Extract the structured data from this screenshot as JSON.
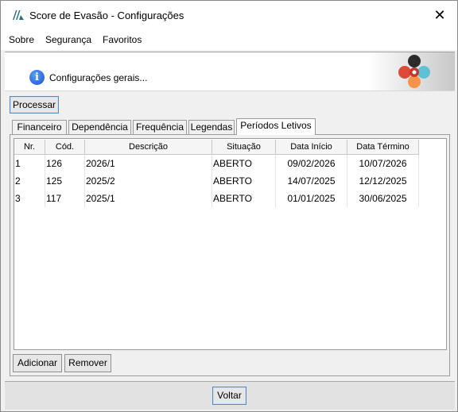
{
  "window": {
    "title": "Score de Evasão - Configurações",
    "close_glyph": "✕"
  },
  "menu": {
    "items": [
      "Sobre",
      "Segurança",
      "Favoritos"
    ]
  },
  "header": {
    "text": "Configurações gerais..."
  },
  "actions": {
    "process_label": "Processar"
  },
  "tabs": [
    "Financeiro",
    "Dependência",
    "Frequência",
    "Legendas",
    "Períodos Letivos"
  ],
  "active_tab": "Períodos Letivos",
  "table": {
    "columns": [
      "Nr.",
      "Cód.",
      "Descrição",
      "Situação",
      "Data Início",
      "Data Término"
    ],
    "rows": [
      [
        "1",
        "126",
        "2026/1",
        "ABERTO",
        "09/02/2026",
        "10/07/2026"
      ],
      [
        "2",
        "125",
        "2025/2",
        "ABERTO",
        "14/07/2025",
        "12/12/2025"
      ],
      [
        "3",
        "117",
        "2025/1",
        "ABERTO",
        "01/01/2025",
        "30/06/2025"
      ]
    ]
  },
  "panel_buttons": {
    "add_label": "Adicionar",
    "remove_label": "Remover"
  },
  "footer": {
    "back_label": "Voltar"
  },
  "icons": {
    "app": "app-logo-icon",
    "close": "close-icon",
    "info": "info-icon",
    "brand": "brand-logo"
  },
  "colors": {
    "info_blue": "#1b4fc4",
    "logo_red": "#e0483a",
    "logo_teal": "#5ec2d6",
    "logo_orange": "#f5934a",
    "logo_dark": "#2b2b2b"
  }
}
